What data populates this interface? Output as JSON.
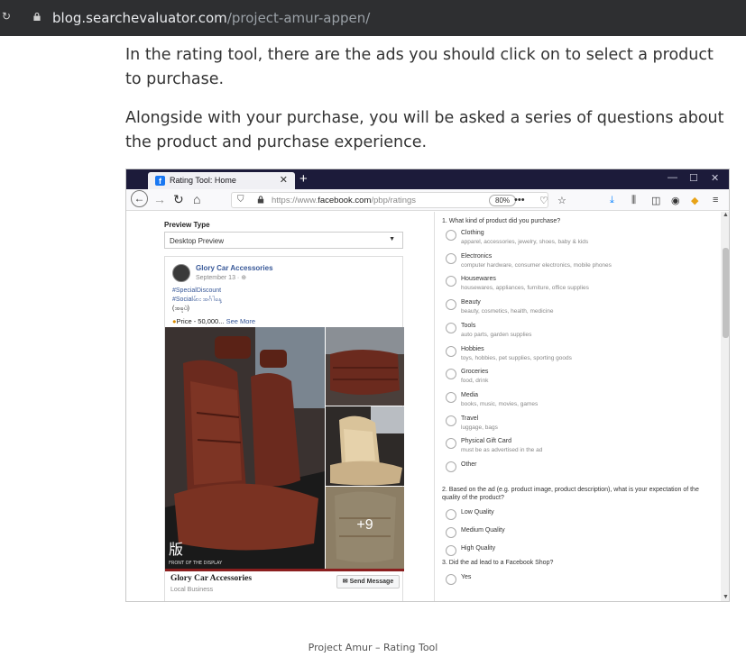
{
  "outer": {
    "host": "blog.searchevaluator.com",
    "path": "/project-amur-appen/"
  },
  "article": {
    "paragraph1": "In the rating tool, there are the ads you should click on to select a product to purchase.",
    "paragraph2": "Alongside with your purchase, you will be asked a series of questions about the product and purchase experience."
  },
  "browser": {
    "tab_title": "Rating Tool: Home",
    "url_prefix": "https://www.",
    "url_host": "facebook.com",
    "url_path": "/pbp/ratings",
    "zoom": "80%"
  },
  "preview": {
    "label": "Preview Type",
    "value": "Desktop Preview"
  },
  "post": {
    "page_name": "Glory Car Accessories",
    "date": "September 13 · ",
    "line1": "#SpecialDiscount",
    "line2": "#Socialမ်ား အင်္ဂါနေ့ ",
    "line3": "(အခုပဲ)",
    "price": "Price - 50,000...",
    "see_more": "See More",
    "more_count": "+9",
    "footer_name": "Glory Car Accessories",
    "footer_sub": "Local Business",
    "send_message": "Send Message",
    "watermark": "版",
    "caption": "FRONT OF THE DISPLAY"
  },
  "survey": {
    "q1": "1. What kind of product did you purchase?",
    "q1_options": [
      {
        "label": "Clothing",
        "sub": "apparel, accessories, jewelry, shoes, baby & kids"
      },
      {
        "label": "Electronics",
        "sub": "computer hardware, consumer electronics, mobile phones"
      },
      {
        "label": "Housewares",
        "sub": "housewares, appliances, furniture, office supplies"
      },
      {
        "label": "Beauty",
        "sub": "beauty, cosmetics, health, medicine"
      },
      {
        "label": "Tools",
        "sub": "auto parts, garden supplies"
      },
      {
        "label": "Hobbies",
        "sub": "toys, hobbies, pet supplies, sporting goods"
      },
      {
        "label": "Groceries",
        "sub": "food, drink"
      },
      {
        "label": "Media",
        "sub": "books, music, movies, games"
      },
      {
        "label": "Travel",
        "sub": "luggage, bags"
      },
      {
        "label": "Physical Gift Card",
        "sub": "must be as advertised in the ad"
      },
      {
        "label": "Other",
        "sub": ""
      }
    ],
    "q2": "2. Based on the ad (e.g. product image, product description), what is your expectation of the quality of the product?",
    "q2_options": [
      "Low Quality",
      "Medium Quality",
      "High Quality"
    ],
    "q3": "3. Did the ad lead to a Facebook Shop?",
    "q3_options": [
      "Yes"
    ]
  },
  "footer": {
    "text": "Project Amur – Rating Tool"
  }
}
